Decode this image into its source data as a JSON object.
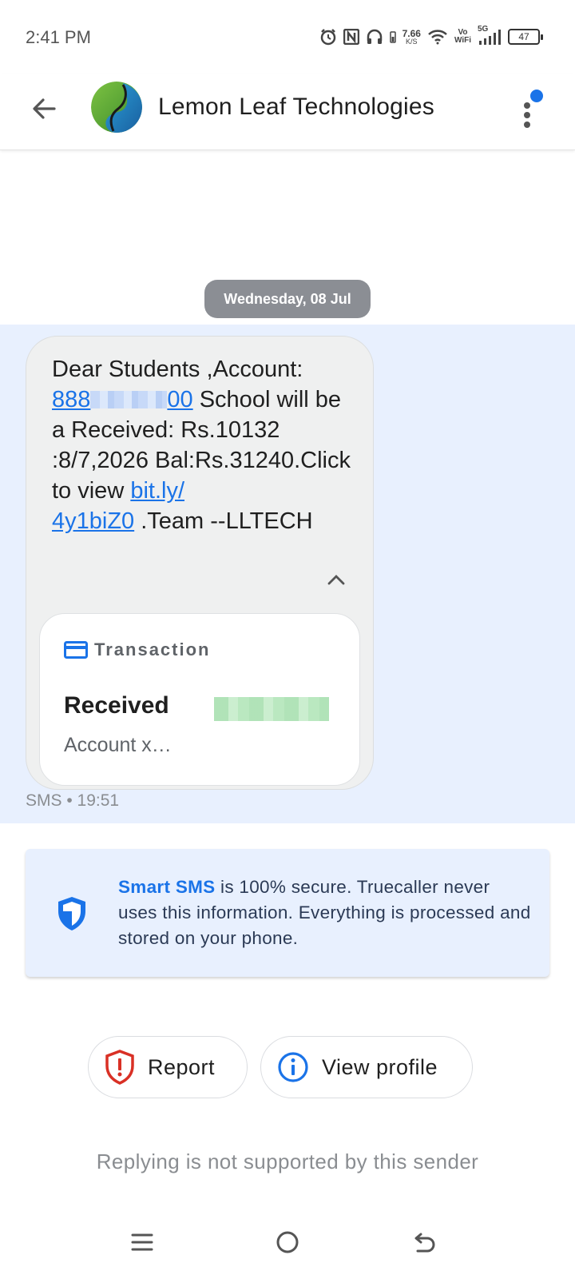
{
  "status_bar": {
    "time": "2:41 PM",
    "net_speed": "7.66",
    "net_unit": "K/S",
    "vowifi_top": "Vo",
    "vowifi_bottom": "WiFi",
    "network": "5G",
    "battery": "47",
    "icons": [
      "alarm-icon",
      "nfc-icon",
      "headset-icon",
      "wifi-icon",
      "signal-icon",
      "battery-icon"
    ]
  },
  "app_bar": {
    "title": "Lemon Leaf Technologies",
    "back_icon": "arrow-back-icon",
    "menu_icon": "more-vert-icon",
    "notification_dot_color": "#1a73e8"
  },
  "conversation": {
    "date_chip": "Wednesday, 08 Jul",
    "message": {
      "line1": "Dear Students ,Account:",
      "account_prefix": "888",
      "account_suffix": "00",
      "text2": " School will be a Received: Rs.10132 :8/7,2026 Bal:Rs.31240.Click to view ",
      "link_part1": "bit.ly/",
      "link_part2": "4y1biZ0",
      "text3": " .Team --LLTECH",
      "meta": "SMS • 19:51"
    },
    "card": {
      "header": "Transaction",
      "title": "Received",
      "subtitle": "Account x…"
    }
  },
  "smart_banner": {
    "highlight": "Smart SMS",
    "text": " is 100% secure. Truecaller never uses this information. Everything is processed and stored on your phone."
  },
  "actions": {
    "report_label": "Report",
    "view_profile_label": "View profile"
  },
  "reply_note": "Replying is not supported by this sender",
  "colors": {
    "accent": "#1a73e8",
    "highlight_bg": "#e8f0fe",
    "report_red": "#d93025"
  }
}
